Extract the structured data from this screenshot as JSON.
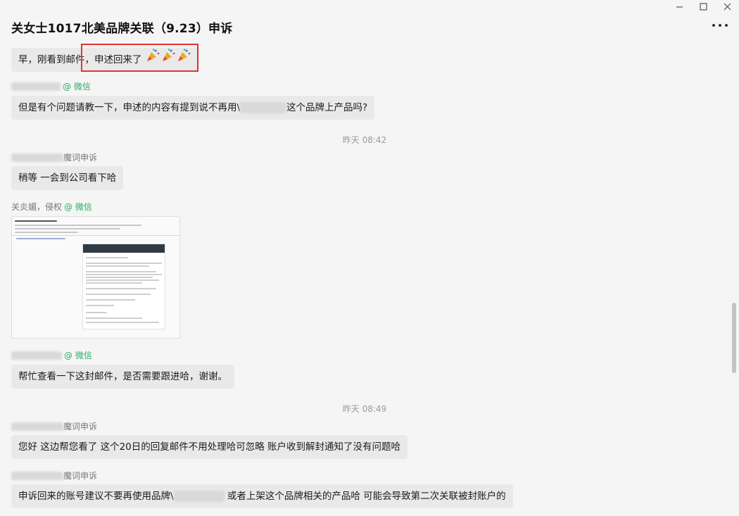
{
  "window": {
    "title": "关女士1017北美品牌关联（9.23）申诉",
    "icons": [
      "minimize-icon",
      "maximize-icon",
      "close-icon",
      "more-icon"
    ]
  },
  "messages": {
    "m1_text": "早，刚看到邮件，申述回来了",
    "m1_emoji": "party-popper-icon",
    "m2_source": "@ 微信",
    "m2_text_before": "但是有个问题请教一下，申述的内容有提到说不再用\\",
    "m2_text_after": "这个品牌上产品吗?",
    "ts1": "昨天 08:42",
    "m3_sender_suffix": "魔词申诉",
    "m3_text": "稍等 一会到公司看下哈",
    "m4_sender": "关炎媚，侵权",
    "m4_source": "@ 微信",
    "m5_source": "@ 微信",
    "m5_text": "帮忙查看一下这封邮件，是否需要跟进哈，谢谢。",
    "ts2": "昨天 08:49",
    "m6_sender_suffix": "魔词申诉",
    "m6_text": "您好 这边帮您看了  这个20日的回复邮件不用处理哈可忽略  账户收到解封通知了没有问题哈",
    "m7_sender_suffix": "魔词申诉",
    "m7_text_before": "申诉回来的账号建议不要再使用品牌\\",
    "m7_text_after": " 或者上架这个品牌相关的产品哈 可能会导致第二次关联被封账户的"
  },
  "colors": {
    "highlight": "#e3342f",
    "wechat_green": "#2aae67",
    "bubble": "#e9e9e9"
  }
}
